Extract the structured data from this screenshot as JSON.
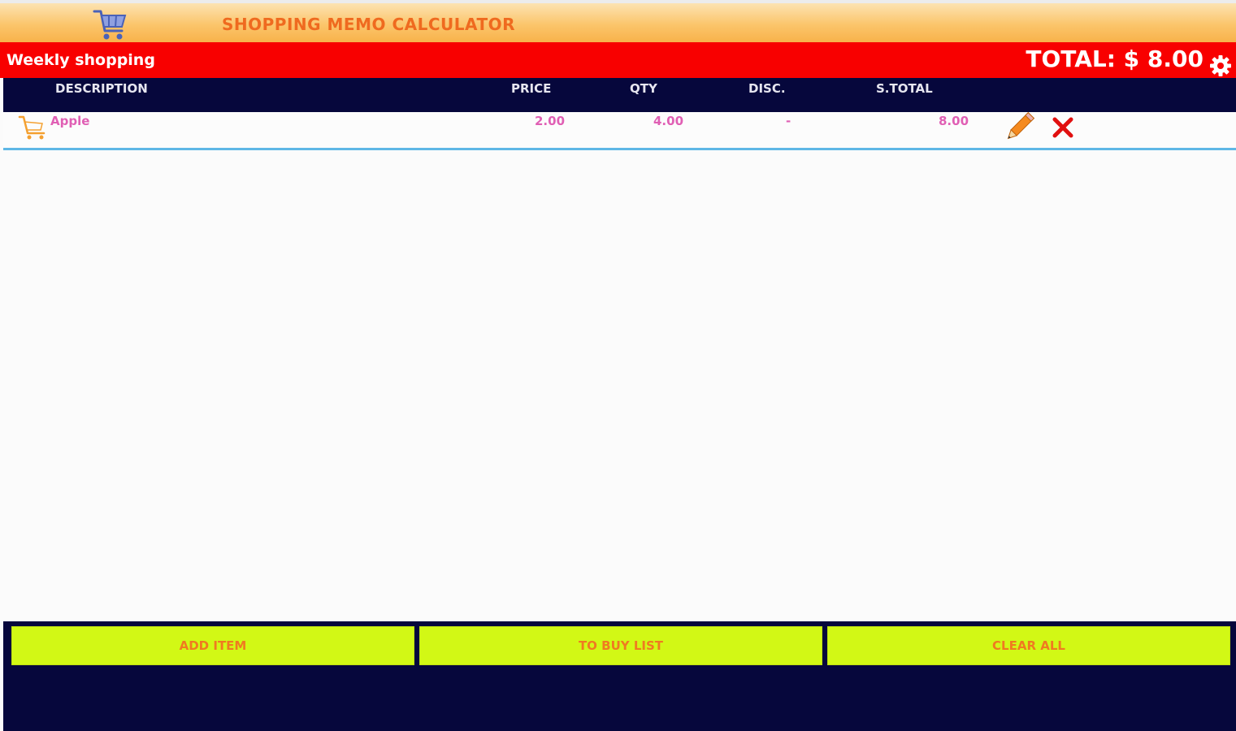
{
  "app": {
    "title": "SHOPPING MEMO CALCULATOR"
  },
  "list": {
    "name": "Weekly shopping",
    "total": "TOTAL: $ 8.00"
  },
  "columns": {
    "description": "DESCRIPTION",
    "price": "PRICE",
    "qty": "QTY",
    "disc": "DISC.",
    "subtotal": "S.TOTAL"
  },
  "items": [
    {
      "description": "Apple",
      "price": "2.00",
      "qty": "4.00",
      "disc": "-",
      "subtotal": "8.00"
    }
  ],
  "buttons": {
    "add_item": "ADD ITEM",
    "to_buy_list": "TO BUY LIST",
    "clear_all": "CLEAR ALL"
  },
  "icons": {
    "app": "shopping-cart-icon",
    "settings": "gear-icon",
    "item": "cart-icon",
    "edit": "pencil-icon",
    "delete": "close-icon"
  },
  "colors": {
    "title_bar": "#f8b24a",
    "list_bar": "#f80000",
    "header_bar": "#06073c",
    "button_bg": "#d2f815",
    "button_text": "#f07a20",
    "item_text": "#e05fb4",
    "row_separator": "#5eb7e6"
  }
}
